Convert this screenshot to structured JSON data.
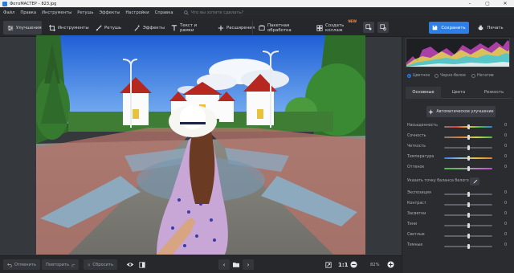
{
  "window": {
    "title": "ФотоМАСТЕР – 823.jpg"
  },
  "menu": {
    "items": [
      "Файл",
      "Правка",
      "Инструменты",
      "Ретушь",
      "Эффекты",
      "Настройки",
      "Справка"
    ],
    "search_placeholder": "Что вы хотите сделать?"
  },
  "toolbar": {
    "enhance": "Улучшения",
    "tools": "Инструменты",
    "retouch": "Ретушь",
    "effects": "Эффекты",
    "text": "Текст и рамки",
    "extensions": "Расширения",
    "batch": "Пакетная обработка",
    "collage": "Создать коллаж",
    "new_badge": "NEW",
    "save": "Сохранить",
    "print": "Печать"
  },
  "bottom": {
    "undo": "Отменить",
    "redo": "Повторить",
    "reset": "Сбросить",
    "ratio": "1:1",
    "zoom": "82%"
  },
  "panel": {
    "modes": [
      "Цветное",
      "Черно-белое",
      "Негатив"
    ],
    "selected_mode": "Цветное",
    "tabs": [
      "Основные",
      "Цвета",
      "Резкость"
    ],
    "active_tab": "Основные",
    "auto_enhance": "Автоматическое улучшение",
    "sliders_top": [
      {
        "label": "Насыщенность",
        "value": "0"
      },
      {
        "label": "Сочность",
        "value": "0"
      },
      {
        "label": "Четкость",
        "value": "0"
      },
      {
        "label": "Температура",
        "value": "0"
      },
      {
        "label": "Оттенок",
        "value": "0"
      }
    ],
    "wb_label": "Указать точку баланса белого",
    "sliders_bottom": [
      {
        "label": "Экспозиция",
        "value": "0"
      },
      {
        "label": "Контраст",
        "value": "0"
      },
      {
        "label": "Засветки",
        "value": "0"
      },
      {
        "label": "Тени",
        "value": "0"
      },
      {
        "label": "Светлые",
        "value": "0"
      },
      {
        "label": "Темные",
        "value": "0"
      }
    ]
  },
  "colors": {
    "accent": "#2f7ee6",
    "new_badge": "#ff8a3c"
  }
}
